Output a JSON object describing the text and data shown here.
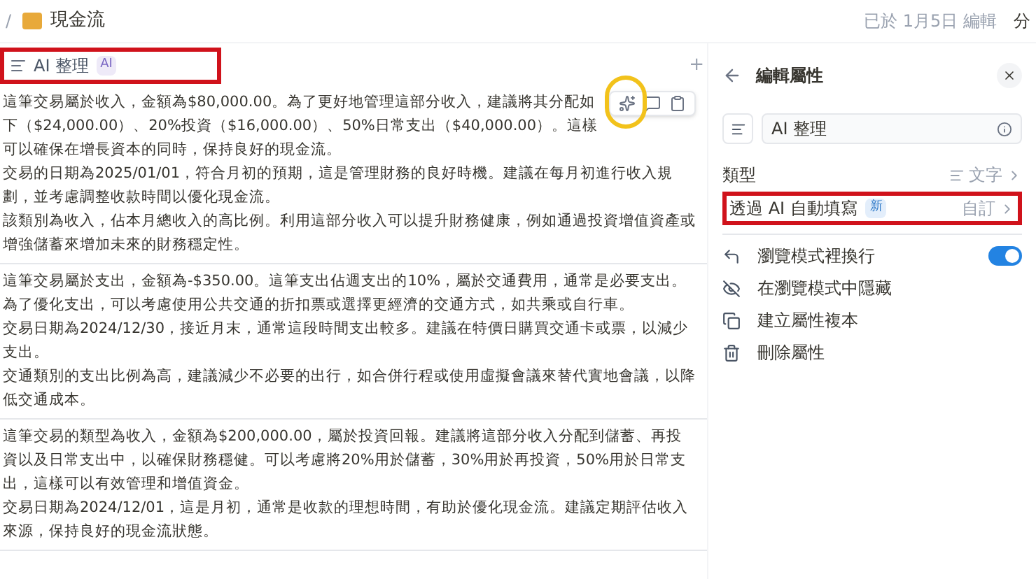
{
  "breadcrumb": {
    "separator": "/",
    "title": "現金流"
  },
  "edited": "已於 1月5日 編輯",
  "share": "分",
  "column": {
    "label": "AI 整理",
    "badge": "AI",
    "highlighted": true
  },
  "add_column": "+",
  "cells": [
    {
      "lines": [
        "這筆交易屬於收入，金額為$80,000.00。為了更好地管理這部分收入，建議將其分配如下（$24,000.00）、20%投資（$16,000.00）、50%日常支出（$40,000.00）。這樣可以確保在增長資本的同時，保持良好的現金流。",
        "交易的日期為2025/01/01，符合月初的預期，這是管理財務的良好時機。建議在每月初進行收入規劃，並考慮調整收款時間以優化現金流。",
        "該類別為收入，佔本月總收入的高比例。利用這部分收入可以提升財務健康，例如通過投資增值資產或增強儲蓄來增加未來的財務穩定性。"
      ],
      "toolbar": true
    },
    {
      "lines": [
        "這筆交易屬於支出，金額為-$350.00。這筆支出佔週支出的10%，屬於交通費用，通常是必要支出。為了優化支出，可以考慮使用公共交通的折扣票或選擇更經濟的交通方式，如共乘或自行車。",
        "交易日期為2024/12/30，接近月末，通常這段時間支出較多。建議在特價日購買交通卡或票，以減少支出。",
        "交通類別的支出比例為高，建議減少不必要的出行，如合併行程或使用虛擬會議來替代實地會議，以降低交通成本。"
      ],
      "toolbar": false
    },
    {
      "lines": [
        "這筆交易的類型為收入，金額為$200,000.00，屬於投資回報。建議將這部分收入分配到儲蓄、再投資以及日常支出中，以確保財務穩健。可以考慮將20%用於儲蓄，30%用於再投資，50%用於日常支出，這樣可以有效管理和增值資金。",
        "交易日期為2024/12/01，這是月初，通常是收款的理想時間，有助於優化現金流。建議定期評估收入來源，保持良好的現金流狀態。"
      ],
      "toolbar": false
    }
  ],
  "panel": {
    "title": "編輯屬性",
    "name_value": "AI 整理",
    "type_row": {
      "label": "類型",
      "value": "文字"
    },
    "autofill_row": {
      "label": "透過 AI 自動填寫",
      "badge": "新",
      "value": "自訂",
      "highlighted": true
    },
    "options": [
      {
        "kind": "toggle",
        "label": "瀏覽模式裡換行",
        "on": true
      },
      {
        "kind": "action",
        "label": "在瀏覽模式中隱藏"
      },
      {
        "kind": "action",
        "label": "建立屬性複本"
      },
      {
        "kind": "action",
        "label": "刪除屬性"
      }
    ]
  }
}
